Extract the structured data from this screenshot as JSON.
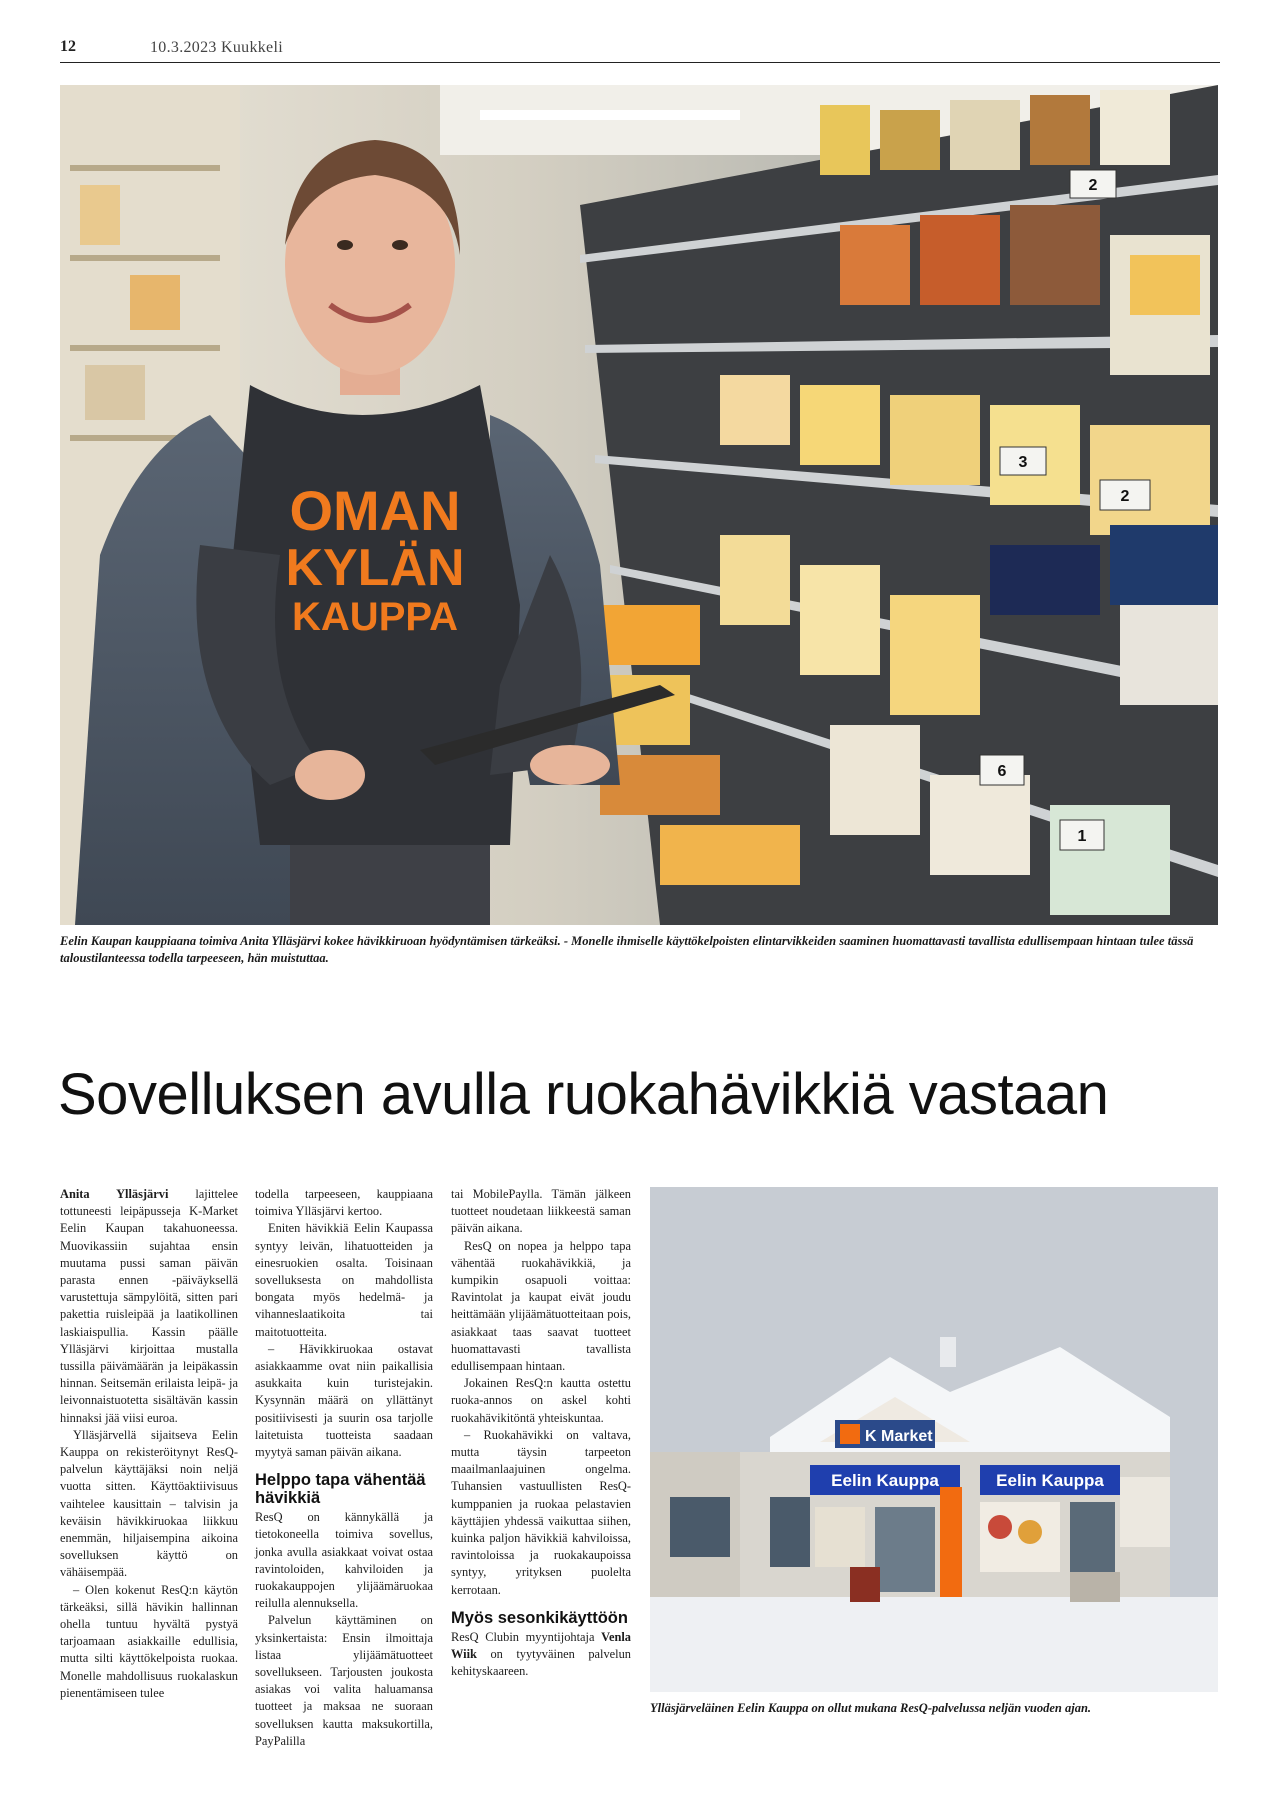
{
  "header": {
    "page_number": "12",
    "date_publication": "10.3.2023 Kuukkeli"
  },
  "photo1": {
    "shirt_text": [
      "OMAN",
      "KYLÄN",
      "KAUPPA"
    ],
    "price_tags": [
      "2",
      "3",
      "2",
      "6",
      "1"
    ],
    "caption": "Eelin Kaupan kauppiaana toimiva Anita Ylläsjärvi kokee hävikkiruoan hyödyntämisen tärkeäksi. - Monelle ihmiselle käyttökelpoisten elintarvikkeiden saaminen huomattavasti tavallista edullisempaan hintaan tulee tässä taloustilanteessa todella tarpeeseen, hän muistuttaa."
  },
  "headline": "Sovelluksen avulla ruokahävikkiä vastaan",
  "column1": {
    "lead_name": "Anita Ylläsjärvi",
    "p1": " lajittelee tottuneesti leipäpusseja K-Market Eelin Kaupan takahuoneessa. Muovikassiin sujahtaa ensin muutama pussi saman päivän parasta ennen -päiväyksellä varustettuja sämpylöitä, sitten pari pakettia ruisleipää ja laatikollinen laskiaispullia. Kassin päälle Ylläsjärvi kirjoittaa mustalla tussilla päivämäärän ja leipäkassin hinnan. Seitsemän erilaista leipä- ja leivonnaistuotetta sisältävän kassin hinnaksi jää viisi euroa.",
    "p2": "Ylläsjärvellä sijaitseva Eelin Kauppa on rekisteröitynyt ResQ-palvelun käyttäjäksi noin neljä vuotta sitten. Käyttöaktiivisuus vaihtelee kausittain – talvisin ja keväisin hävikkiruokaa liikkuu enemmän, hiljaisempina aikoina sovelluksen käyttö on vähäisempää.",
    "p3": "– Olen kokenut ResQ:n käytön tärkeäksi, sillä hävikin hallinnan ohella tuntuu hyvältä pystyä tarjoamaan asiakkaille edullisia, mutta silti käyttökelpoista ruokaa. Monelle mahdollisuus ruokalaskun pienentämiseen tulee"
  },
  "column2": {
    "p1": "todella tarpeeseen, kauppiaana toimiva Ylläsjärvi kertoo.",
    "p2": "Eniten hävikkiä Eelin Kaupassa syntyy leivän, lihatuotteiden ja einesruokien osalta. Toisinaan sovelluksesta on mahdollista bongata myös hedelmä- ja vihannes­laatikoita tai maitotuotteita.",
    "p3": "– Hävikkiruokaa ostavat asiakkaamme ovat niin paikallisia asukkaita kuin turistejakin. Kysynnän määrä on yllättänyt positiivisesti ja suurin osa tarjolle laitetuista tuotteista saadaan myytyä saman päivän aikana.",
    "subhead": "Helppo tapa vähentää hävikkiä",
    "p4": "ResQ on kännykällä ja tietokoneella toimiva sovellus, jonka avulla asiakkaat voivat ostaa ravintoloiden, kahviloiden ja ruokakauppojen ylijäämäruokaa reilulla alennuksella.",
    "p5": "Palvelun käyttäminen on yksinkertaista: Ensin ilmoittaja listaa ylijäämätuotteet sovellukseen. Tarjousten joukosta asiakas voi valita haluamansa tuotteet ja maksaa ne suoraan sovelluksen kautta maksukortilla, PayPalilla"
  },
  "column3": {
    "p1": "tai MobilePaylla. Tämän jälkeen tuotteet noudetaan liikkeestä saman päivän aikana.",
    "p2": "ResQ on nopea ja helppo tapa vähentää ruokahävikkiä, ja kumpikin osapuoli voittaa: Ravintolat ja kaupat eivät joudu heittämään ylijäämätuotteitaan pois, asiakkaat taas saavat tuotteet huomattavasti tavallista edullisempaan hintaan.",
    "p3": "Jokainen ResQ:n kautta ostettu ruoka-annos on askel kohti ruokahävikitöntä yhteiskuntaa.",
    "p4": "– Ruokahävikki on valtava, mutta täysin tarpeeton maailmanlaajuinen ongelma. Tuhansien vastuullisten ResQ-kumppanien ja ruokaa pelastavien käyttäjien yhdessä vaikuttaa siihen, kuinka paljon hävikkiä kahviloissa, ravintoloissa ja ruokakaupoissa syntyy, yrityksen puolelta kerrotaan.",
    "subhead": "Myös sesonkikäyttöön",
    "p5_pre": "ResQ Clubin myyntijohtaja ",
    "p5_name": "Venla Wiik",
    "p5_post": " on tyytyväinen palvelun kehityskaareen."
  },
  "photo2": {
    "sign_kmarket": "K Market",
    "sign_store": "Eelin Kauppa",
    "sign_store_right": "Eelin Kauppa",
    "caption": "Ylläsjärveläinen Eelin Kauppa on ollut mukana ResQ-palvelussa neljän vuoden ajan."
  },
  "colors": {
    "shirt_text": "#f07a1e",
    "kmarket_orange": "#f26b10",
    "store_sign_blue": "#1f3fae"
  }
}
